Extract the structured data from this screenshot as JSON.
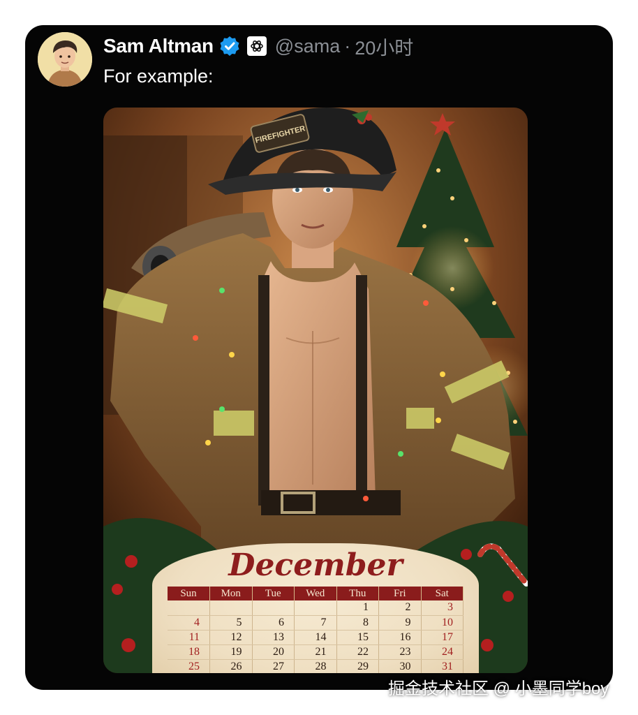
{
  "tweet": {
    "author_name": "Sam Altman",
    "handle": "@sama",
    "separator": "·",
    "time": "20小时",
    "text": "For example:",
    "verified_icon": "verified-badge-icon",
    "org_icon": "openai-logo-icon",
    "accent_color": "#1d9bf0"
  },
  "media": {
    "helmet_text": "FIREFIGHTER",
    "calendar": {
      "month": "December",
      "weekdays": [
        "Sun",
        "Mon",
        "Tue",
        "Wed",
        "Thu",
        "Fri",
        "Sat"
      ],
      "weeks": [
        [
          "",
          "",
          "",
          "",
          "1",
          "2",
          "3"
        ],
        [
          "4",
          "5",
          "6",
          "7",
          "8",
          "9",
          "10"
        ],
        [
          "11",
          "12",
          "13",
          "14",
          "15",
          "16",
          "17"
        ],
        [
          "18",
          "19",
          "20",
          "21",
          "22",
          "23",
          "24"
        ],
        [
          "25",
          "26",
          "27",
          "28",
          "29",
          "30",
          "31"
        ]
      ]
    }
  },
  "watermark": "掘金技术社区 @ 小墨同学boy"
}
